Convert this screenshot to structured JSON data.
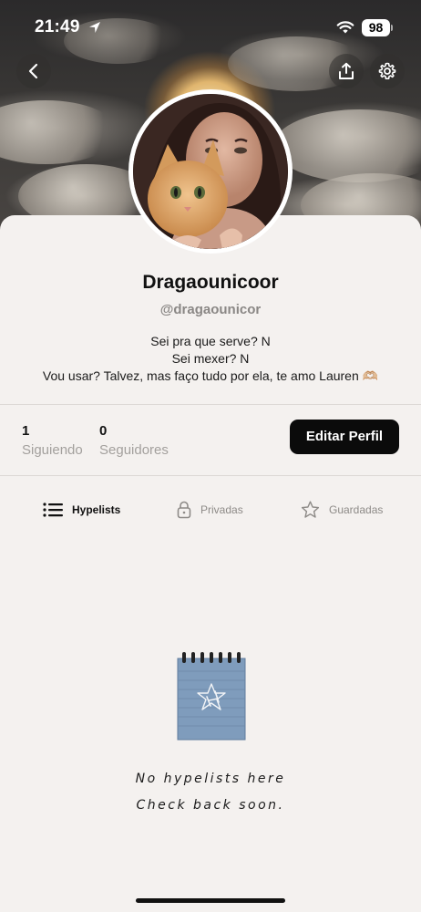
{
  "status_bar": {
    "time": "21:49",
    "battery": "98"
  },
  "profile": {
    "name": "Dragaounicoor",
    "handle": "@dragaounicor",
    "bio": [
      "Sei pra que serve? N",
      "Sei mexer? N",
      "Vou usar? Talvez, mas faço tudo por ela, te amo Lauren 🫶🏼"
    ]
  },
  "stats": {
    "following": {
      "count": "1",
      "label": "Siguiendo"
    },
    "followers": {
      "count": "0",
      "label": "Seguidores"
    }
  },
  "edit_button": "Editar Perfil",
  "tabs": [
    {
      "label": "Hypelists",
      "icon": "list-icon",
      "active": true
    },
    {
      "label": "Privadas",
      "icon": "lock-icon",
      "active": false
    },
    {
      "label": "Guardadas",
      "icon": "star-icon",
      "active": false
    }
  ],
  "empty_state": {
    "line1": "No hypelists here",
    "line2": "Check back soon."
  },
  "colors": {
    "background": "#f4f1ef",
    "button": "#0b0b0b",
    "muted_text": "#a3a09d"
  }
}
